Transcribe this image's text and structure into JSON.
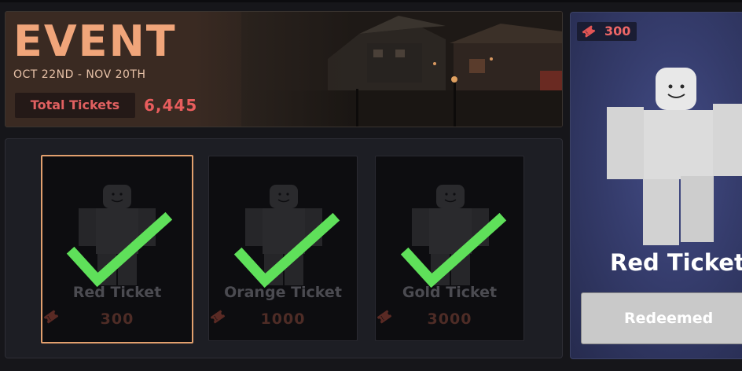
{
  "event": {
    "title": "EVENT",
    "dates": "OCT 22ND - NOV 20TH",
    "total_tickets_label": "Total Tickets",
    "total_tickets_value": "6,445"
  },
  "rewards": [
    {
      "name": "Red Ticket",
      "price": "300",
      "redeemed": true,
      "selected": true
    },
    {
      "name": "Orange Ticket",
      "price": "1000",
      "redeemed": true,
      "selected": false
    },
    {
      "name": "Gold Ticket",
      "price": "3000",
      "redeemed": true,
      "selected": false
    }
  ],
  "detail": {
    "cost": "300",
    "item_name": "Red Ticket",
    "button_label": "Redeemed"
  },
  "colors": {
    "accent_title": "#f0a57a",
    "ticket_red": "#e95d5d",
    "check_green": "#5fe05a",
    "selected_border": "#e2a06e",
    "detail_bg": "#353c6c"
  },
  "icons": {
    "ticket": "ticket-icon",
    "check": "checkmark-icon"
  }
}
